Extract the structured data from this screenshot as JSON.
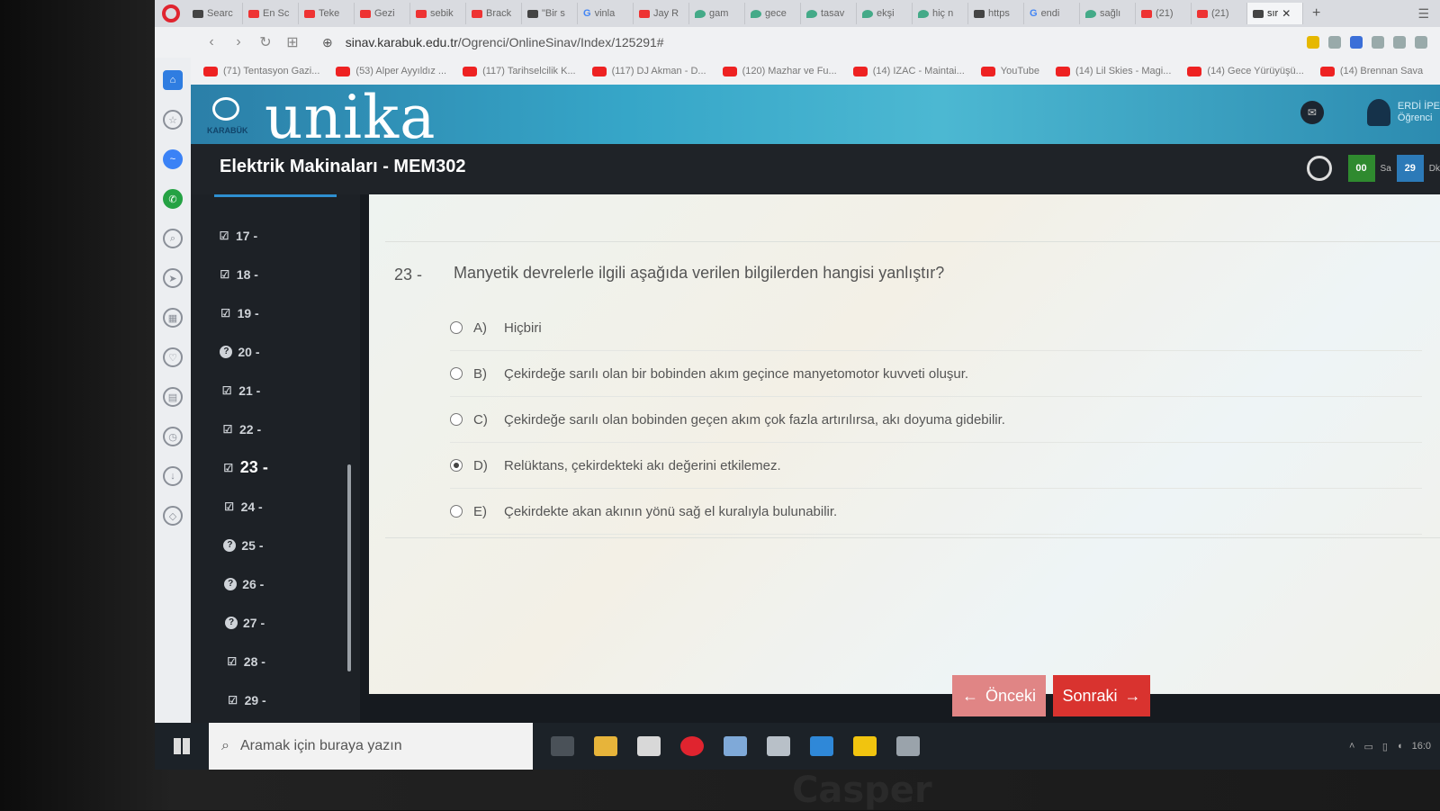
{
  "browser": {
    "tabs": [
      {
        "label": "Searc",
        "icon": "opera-search-icon"
      },
      {
        "label": "En Sc",
        "icon": "youtube-icon"
      },
      {
        "label": "Teke",
        "icon": "youtube-icon"
      },
      {
        "label": "Gezi",
        "icon": "youtube-icon"
      },
      {
        "label": "sebik",
        "icon": "youtube-icon"
      },
      {
        "label": "Brack",
        "icon": "youtube-icon"
      },
      {
        "label": "\"Bir s",
        "icon": "page-icon"
      },
      {
        "label": "vinla",
        "icon": "google-icon"
      },
      {
        "label": "Jay R",
        "icon": "youtube-icon"
      },
      {
        "label": "gam",
        "icon": "leaf-icon"
      },
      {
        "label": "gece",
        "icon": "leaf-icon"
      },
      {
        "label": "tasav",
        "icon": "leaf-icon"
      },
      {
        "label": "ekşi",
        "icon": "leaf-icon"
      },
      {
        "label": "hiç n",
        "icon": "leaf-icon"
      },
      {
        "label": "https",
        "icon": "page-icon"
      },
      {
        "label": "endi",
        "icon": "google-icon"
      },
      {
        "label": "sağlı",
        "icon": "leaf-icon"
      },
      {
        "label": "(21)",
        "icon": "youtube-icon"
      },
      {
        "label": "(21)",
        "icon": "youtube-icon"
      },
      {
        "label": "sır",
        "icon": "page-icon",
        "active": true
      }
    ],
    "url_host": "sinav.karabuk.edu.tr",
    "url_path": "/Ogrenci/OnlineSinav/Index/125291#",
    "bookmarks": [
      "(71) Tentasyon Gazi...",
      "(53) Alper Ayyıldız ...",
      "(117) Tarihselcilik K...",
      "(117) DJ Akman - D...",
      "(120) Mazhar ve Fu...",
      "(14) IZAC - Maintai...",
      "YouTube",
      "(14) Lil Skies - Magi...",
      "(14) Gece Yürüyüşü...",
      "(14) Brennan Sava"
    ]
  },
  "site": {
    "brand": "unika",
    "logo_label": "KARABÜK",
    "user_name": "ERDİ İPE",
    "user_role": "Öğrenci",
    "course_title": "Elektrik Makinaları - MEM302",
    "timer_hours": "00",
    "timer_hours_unit": "Sa",
    "timer_minutes": "29",
    "timer_minutes_unit": "Dk"
  },
  "question_nav": [
    {
      "label": "17 -",
      "status": "answered"
    },
    {
      "label": "18 -",
      "status": "answered"
    },
    {
      "label": "19 -",
      "status": "answered"
    },
    {
      "label": "20 -",
      "status": "unanswered"
    },
    {
      "label": "21 -",
      "status": "answered"
    },
    {
      "label": "22 -",
      "status": "answered"
    },
    {
      "label": "23 -",
      "status": "answered",
      "current": true
    },
    {
      "label": "24 -",
      "status": "answered"
    },
    {
      "label": "25 -",
      "status": "unanswered"
    },
    {
      "label": "26 -",
      "status": "unanswered"
    },
    {
      "label": "27 -",
      "status": "unanswered"
    },
    {
      "label": "28 -",
      "status": "answered"
    },
    {
      "label": "29 -",
      "status": "answered"
    }
  ],
  "question": {
    "number": "23 -",
    "text": "Manyetik devrelerle ilgili aşağıda verilen bilgilerden hangisi yanlıştır?",
    "options": [
      {
        "letter": "A)",
        "text": "Hiçbiri",
        "selected": false
      },
      {
        "letter": "B)",
        "text": "Çekirdeğe sarılı olan bir bobinden akım geçince manyetomotor kuvveti oluşur.",
        "selected": false
      },
      {
        "letter": "C)",
        "text": "Çekirdeğe sarılı olan bobinden geçen akım çok fazla artırılırsa, akı doyuma gidebilir.",
        "selected": false
      },
      {
        "letter": "D)",
        "text": "Relüktans, çekirdekteki akı değerini etkilemez.",
        "selected": true
      },
      {
        "letter": "E)",
        "text": "Çekirdekte akan akının yönü sağ el kuralıyla bulunabilir.",
        "selected": false
      }
    ]
  },
  "buttons": {
    "prev": "Önceki",
    "next": "Sonraki"
  },
  "taskbar": {
    "search_placeholder": "Aramak için buraya yazın",
    "clock": "16:0"
  },
  "bezel_brand": "Casper",
  "colors": {
    "banner": "#36a6c8",
    "next_button": "#d9332f",
    "prev_button": "#e08585",
    "timer_hours_bg": "#2f8a2f",
    "timer_minutes_bg": "#2c7ab8"
  }
}
